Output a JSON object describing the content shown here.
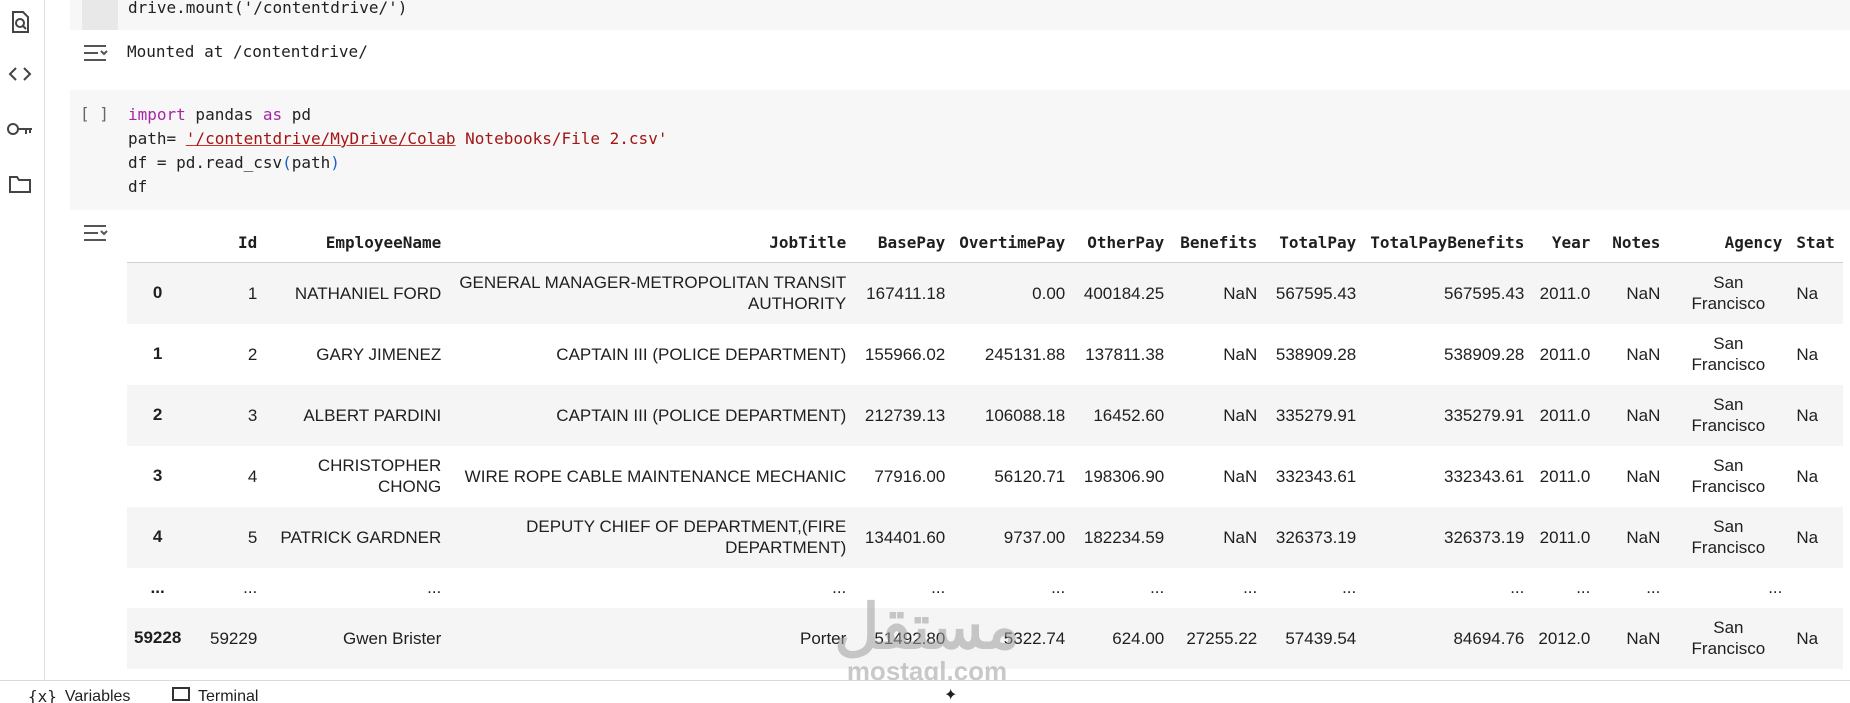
{
  "rail": {
    "icons": [
      "search-document-icon",
      "code-icon",
      "key-icon",
      "folder-icon"
    ]
  },
  "cell1": {
    "code": "drive.mount('/contentdrive/')",
    "output": "Mounted at /contentdrive/"
  },
  "cell2": {
    "run_label": "[ ]",
    "lines": {
      "l1_kw_import": "import",
      "l1_mid": " pandas ",
      "l1_kw_as": "as",
      "l1_end": " pd",
      "l2_pre": "path= ",
      "l2_str_a": "'/contentdrive/MyDrive/",
      "l2_str_b": "Colab",
      "l2_str_c": " Notebooks/File 2.csv'",
      "l3_pre": "df = pd.read_csv",
      "l3_paren_open": "(",
      "l3_arg": "path",
      "l3_paren_close": ")",
      "l4": "df"
    }
  },
  "table": {
    "columns": [
      "",
      "Id",
      "EmployeeName",
      "JobTitle",
      "BasePay",
      "OvertimePay",
      "OtherPay",
      "Benefits",
      "TotalPay",
      "TotalPayBenefits",
      "Year",
      "Notes",
      "Agency",
      "Stat"
    ],
    "rows": [
      [
        "0",
        "1",
        "NATHANIEL FORD",
        "GENERAL MANAGER-METROPOLITAN TRANSIT AUTHORITY",
        "167411.18",
        "0.00",
        "400184.25",
        "NaN",
        "567595.43",
        "567595.43",
        "2011.0",
        "NaN",
        "San Francisco",
        "Na"
      ],
      [
        "1",
        "2",
        "GARY JIMENEZ",
        "CAPTAIN III (POLICE DEPARTMENT)",
        "155966.02",
        "245131.88",
        "137811.38",
        "NaN",
        "538909.28",
        "538909.28",
        "2011.0",
        "NaN",
        "San Francisco",
        "Na"
      ],
      [
        "2",
        "3",
        "ALBERT PARDINI",
        "CAPTAIN III (POLICE DEPARTMENT)",
        "212739.13",
        "106088.18",
        "16452.60",
        "NaN",
        "335279.91",
        "335279.91",
        "2011.0",
        "NaN",
        "San Francisco",
        "Na"
      ],
      [
        "3",
        "4",
        "CHRISTOPHER CHONG",
        "WIRE ROPE CABLE MAINTENANCE MECHANIC",
        "77916.00",
        "56120.71",
        "198306.90",
        "NaN",
        "332343.61",
        "332343.61",
        "2011.0",
        "NaN",
        "San Francisco",
        "Na"
      ],
      [
        "4",
        "5",
        "PATRICK GARDNER",
        "DEPUTY CHIEF OF DEPARTMENT,(FIRE DEPARTMENT)",
        "134401.60",
        "9737.00",
        "182234.59",
        "NaN",
        "326373.19",
        "326373.19",
        "2011.0",
        "NaN",
        "San Francisco",
        "Na"
      ],
      [
        "...",
        "...",
        "...",
        "...",
        "...",
        "...",
        "...",
        "...",
        "...",
        "...",
        "...",
        "...",
        "...",
        ""
      ],
      [
        "59228",
        "59229",
        "Gwen Brister",
        "Porter",
        "51492.80",
        "5322.74",
        "624.00",
        "27255.22",
        "57439.54",
        "84694.76",
        "2012.0",
        "NaN",
        "San Francisco",
        "Na"
      ]
    ]
  },
  "bottom_bar": {
    "variables": "Variables",
    "terminal": "Terminal"
  },
  "watermark": {
    "arabic": "مستقل",
    "latin": "mostaql.com"
  }
}
